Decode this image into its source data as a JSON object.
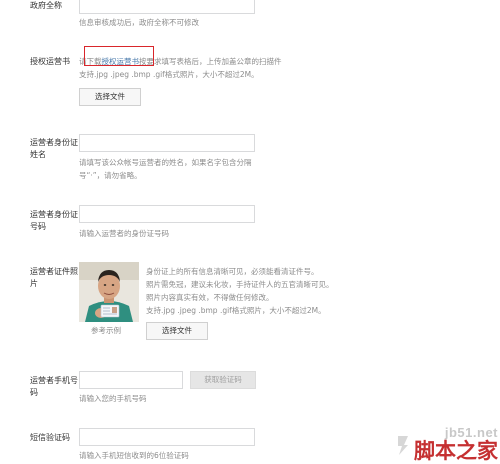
{
  "org_full_name": {
    "label": "政府全称",
    "hint": "信息审核成功后，政府全称不可修改"
  },
  "authorization": {
    "label": "授权运营书",
    "hint_prefix": "请下载",
    "hint_link": "授权运营书",
    "hint_suffix": "按要求填写表格后，上传加盖公章的扫描件",
    "format_hint": "支持.jpg .jpeg .bmp .gif格式照片，大小不超过2M。",
    "select_file_button": "选择文件"
  },
  "operator_name": {
    "label": "运营者身份证姓名",
    "hint_line1": "请填写该公众帐号运营者的姓名，如果名字包含分隔",
    "hint_line2": "号“·”，请勿省略。"
  },
  "operator_id": {
    "label": "运营者身份证号码",
    "hint": "请输入运营者的身份证号码"
  },
  "operator_photo": {
    "label": "运营者证件照片",
    "desc_lines": [
      "身份证上的所有信息清晰可见，必须能看清证件号。",
      "照片需免冠，建议未化妆，手持证件人的五官清晰可见。",
      "照片内容真实有效，不得做任何修改。",
      "支持.jpg .jpeg .bmp .gif格式照片，大小不超过2M。"
    ],
    "example_caption": "参考示例",
    "select_file_button": "选择文件"
  },
  "operator_phone": {
    "label": "运营者手机号码",
    "hint": "请输入您的手机号码",
    "get_code_button": "获取验证码"
  },
  "sms_code": {
    "label": "短信验证码",
    "hint": "请输入手机短信收到的6位验证码"
  },
  "watermark": {
    "site": "jb51.net",
    "brand": "脚本之家"
  },
  "colors": {
    "highlight_box": "#d9262b",
    "link": "#4476a8",
    "hint_text": "#8c8c8c"
  }
}
